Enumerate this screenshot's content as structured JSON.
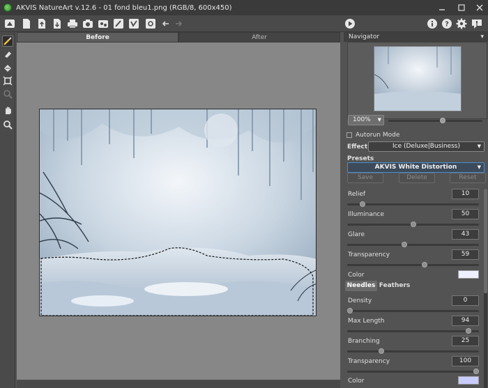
{
  "window": {
    "title": "AKVIS NatureArt v.12.6 - 01 fond bleu1.png (RGB/8, 600x450)",
    "controls": [
      "minimize",
      "maximize",
      "close"
    ]
  },
  "toolbar": {
    "left_icons": [
      "home-icon",
      "new-document-icon",
      "open-icon",
      "save-icon",
      "print-icon",
      "batch-icon",
      "share-icon",
      "brush-settings-icon",
      "stamp-icon",
      "settings-gear-icon",
      "undo-arrow-icon",
      "redo-arrow-icon"
    ],
    "right_icons": [
      "run-play-icon",
      "info-icon",
      "help-icon",
      "preferences-gear-icon",
      "notification-icon"
    ]
  },
  "tools": [
    "effect-brush-icon",
    "eraser-icon",
    "fill-icon",
    "crop-icon",
    "history-brush-icon",
    "hand-icon",
    "zoom-icon"
  ],
  "tabs": {
    "before": "Before",
    "after": "After"
  },
  "navigator": {
    "title": "Navigator",
    "zoom": "100%",
    "zoom_level": 0.58
  },
  "settings": {
    "autorun_label": "Autorun Mode",
    "effect_label": "Effect:",
    "effect_value": "Ice (Deluxe|Business)",
    "presets_label": "Presets",
    "preset_value": "AKVIS White Distortion",
    "save_label": "Save",
    "delete_label": "Delete",
    "reset_label": "Reset"
  },
  "params": [
    {
      "label": "Relief",
      "value": "10",
      "fraction": 0.1
    },
    {
      "label": "Illuminance",
      "value": "50",
      "fraction": 0.5
    },
    {
      "label": "Glare",
      "value": "43",
      "fraction": 0.43
    },
    {
      "label": "Transparency",
      "value": "59",
      "fraction": 0.59
    }
  ],
  "color1": {
    "label": "Color",
    "swatch": "#eef0ff"
  },
  "subtabs": {
    "needles": "Needles",
    "feathers": "Feathers"
  },
  "needles": [
    {
      "label": "Density",
      "value": "0",
      "fraction": 0.0
    },
    {
      "label": "Max Length",
      "value": "94",
      "fraction": 0.94
    },
    {
      "label": "Branching",
      "value": "25",
      "fraction": 0.25
    },
    {
      "label": "Transparency",
      "value": "100",
      "fraction": 1.0
    }
  ],
  "color2": {
    "label": "Color",
    "swatch": "#c8ccff"
  },
  "colors": {
    "accent": "#4a90d0",
    "panel": "#535353",
    "canvas_bg": "#878787"
  }
}
